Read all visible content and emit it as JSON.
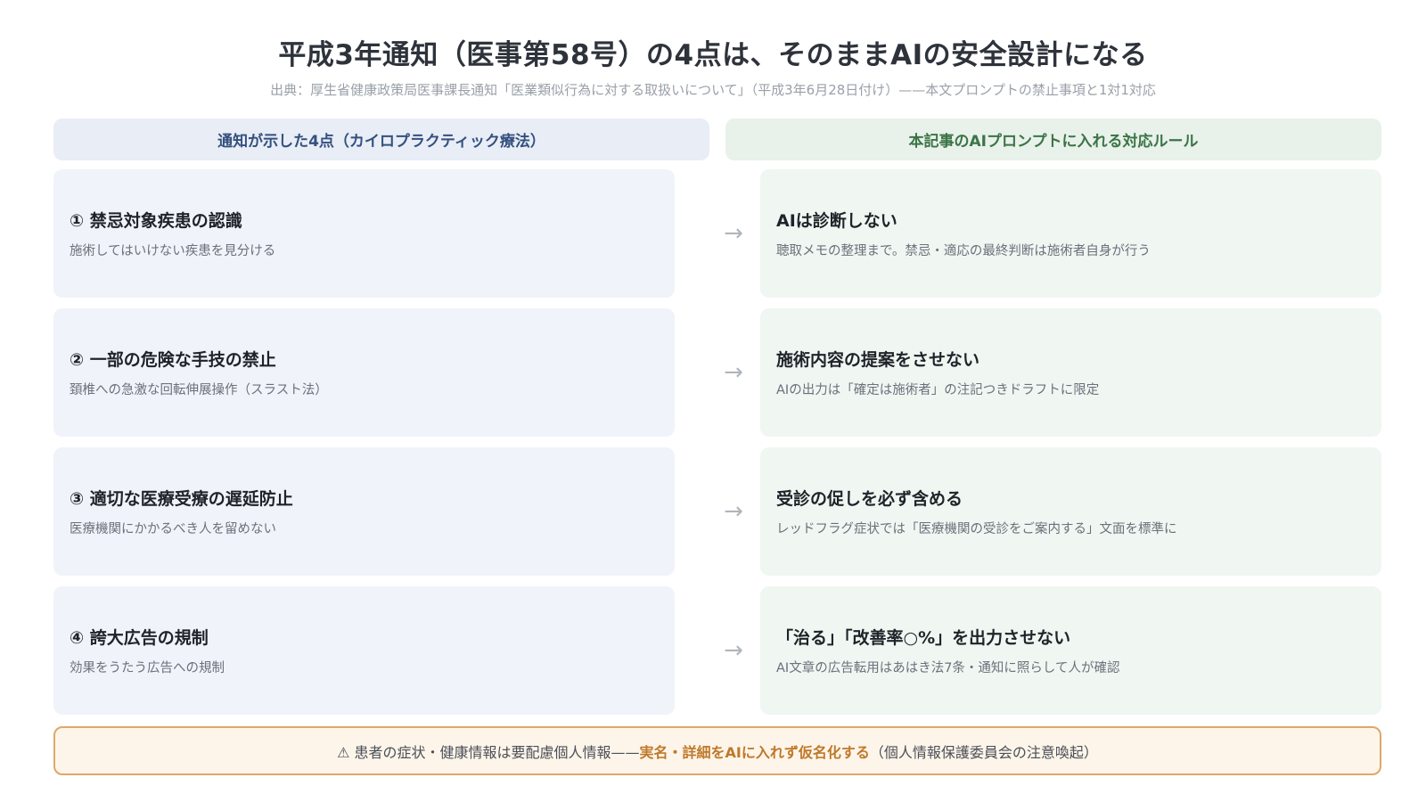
{
  "title": "平成3年通知（医事第58号）の4点は、そのままAIの安全設計になる",
  "subtitle": "出典：厚生省健康政策局医事課長通知「医業類似行為に対する取扱いについて」（平成3年6月28日付け）——本文プロンプトの禁止事項と1対1対応",
  "headers": {
    "left": "通知が示した4点（カイロプラクティック療法）",
    "right": "本記事のAIプロンプトに入れる対応ルール"
  },
  "arrow_glyph": "→",
  "rows": [
    {
      "left_title": "① 禁忌対象疾患の認識",
      "left_desc": "施術してはいけない疾患を見分ける",
      "right_title": "AIは診断しない",
      "right_desc": "聴取メモの整理まで。禁忌・適応の最終判断は施術者自身が行う"
    },
    {
      "left_title": "② 一部の危険な手技の禁止",
      "left_desc": "頚椎への急激な回転伸展操作（スラスト法）",
      "right_title": "施術内容の提案をさせない",
      "right_desc": "AIの出力は「確定は施術者」の注記つきドラフトに限定"
    },
    {
      "left_title": "③ 適切な医療受療の遅延防止",
      "left_desc": "医療機関にかかるべき人を留めない",
      "right_title": "受診の促しを必ず含める",
      "right_desc": "レッドフラグ症状では「医療機関の受診をご案内する」文面を標準に"
    },
    {
      "left_title": "④ 誇大広告の規制",
      "left_desc": "効果をうたう広告への規制",
      "right_title": "「治る」「改善率○%」を出力させない",
      "right_desc": "AI文章の広告転用はあはき法7条・通知に照らして人が確認"
    }
  ],
  "notice": {
    "prefix": "⚠ 患者の症状・健康情報は要配慮個人情報——",
    "highlight": "実名・詳細をAIに入れず仮名化する",
    "suffix": "（個人情報保護委員会の注意喚起）"
  },
  "colors": {
    "left_header_bg": "#e8edf6",
    "right_header_bg": "#e8f1ea",
    "left_card_bg": "#f0f3f9",
    "right_card_bg": "#f0f6f2",
    "notice_border": "#dca86a",
    "notice_highlight": "#c0782a"
  }
}
